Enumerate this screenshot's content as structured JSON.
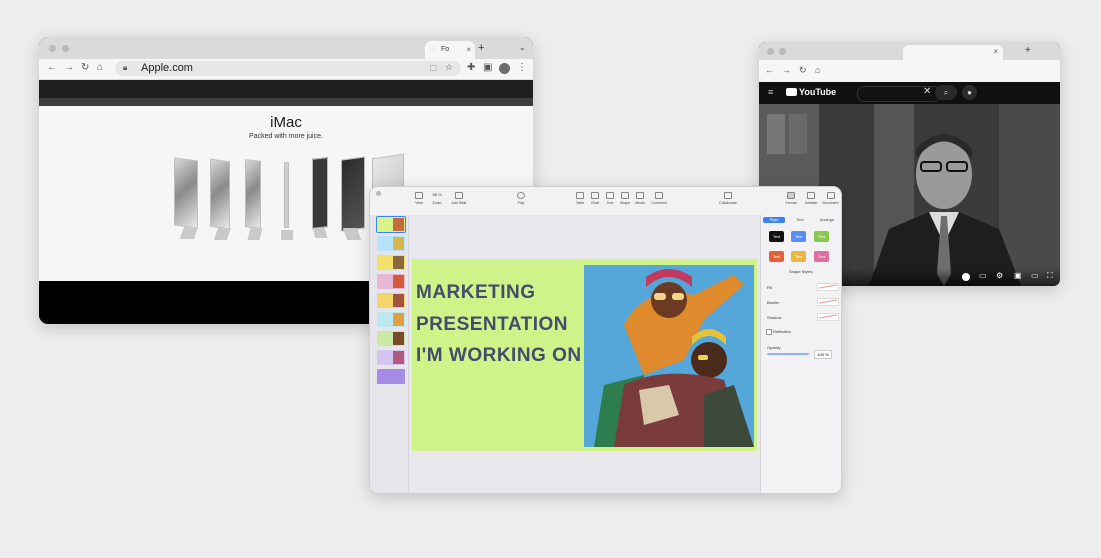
{
  "browser_apple": {
    "tab_title": "Fo",
    "url": "Apple.com",
    "icons": [
      "back-icon",
      "forward-icon",
      "reload-icon",
      "home-icon",
      "lock-icon",
      "share-icon",
      "star-icon",
      "extensions-icon",
      "sidepanel-icon",
      "menu-icon"
    ]
  },
  "apple_page": {
    "title": "iMac",
    "tagline": "Packed with more juice."
  },
  "browser_youtube": {
    "logo_text": "YouTube",
    "icons": [
      "back-icon",
      "forward-icon",
      "reload-icon",
      "home-icon",
      "search-icon",
      "mic-icon",
      "clear-icon"
    ]
  },
  "keynote": {
    "toolbar": [
      {
        "label": "View"
      },
      {
        "label": "Zoom"
      },
      {
        "label": "Add Slide"
      },
      {
        "label": "Play"
      },
      {
        "label": "Table"
      },
      {
        "label": "Chart"
      },
      {
        "label": "Text"
      },
      {
        "label": "Shape"
      },
      {
        "label": "Media"
      },
      {
        "label": "Comment"
      },
      {
        "label": "Collaborate"
      },
      {
        "label": "Format"
      },
      {
        "label": "Animate"
      },
      {
        "label": "Document"
      }
    ],
    "zoom_value": "88 %",
    "slide_title_lines": [
      "MARKETING",
      "PRESENTATION",
      "I'M WORKING ON"
    ],
    "inspector": {
      "tabs": [
        "Style",
        "Text",
        "Arrange"
      ],
      "style_button_text": "Text",
      "style_colors": [
        "#111111",
        "#5a8df0",
        "#8cc653",
        "#e3613d",
        "#e9b543",
        "#e06fa1"
      ],
      "shape_styles_label": "Shape Styles",
      "rows": [
        "Fill",
        "Border",
        "Shadow",
        "Reflection"
      ],
      "opacity_label": "Opacity",
      "opacity_value": "100 %"
    }
  },
  "colors": {
    "slide_background": "#cdf389",
    "slide_title": "#444c6c",
    "photo_background": "#55a7d9",
    "keynote_accent": "#3b82f6"
  }
}
